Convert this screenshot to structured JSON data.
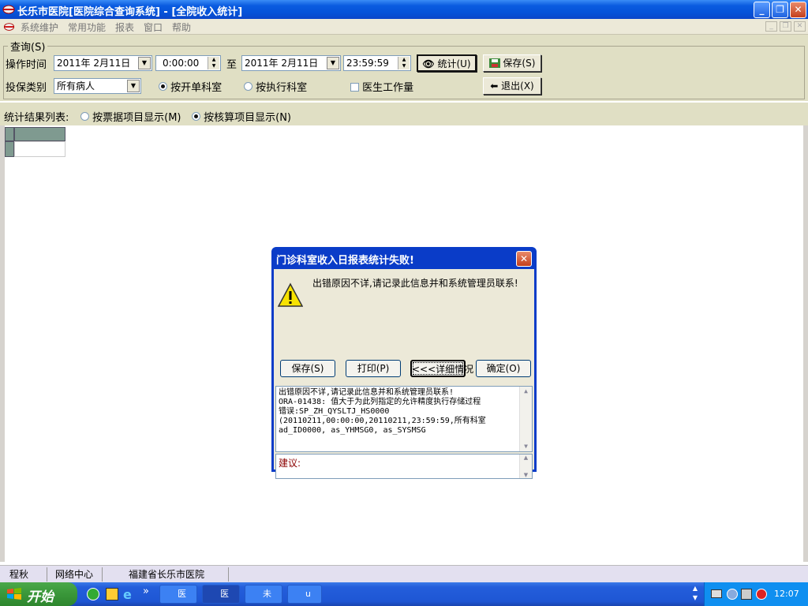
{
  "window": {
    "title": "长乐市医院[医院综合查询系统] - [全院收入统计]",
    "min": "_",
    "restore": "❐",
    "close": "✕"
  },
  "menu": {
    "items": [
      "系统维护",
      "常用功能",
      "报表",
      "窗口",
      "帮助"
    ],
    "mdi_min": "_",
    "mdi_restore": "❐",
    "mdi_close": "✕"
  },
  "query": {
    "group_label": "查询(S)",
    "time_label": "操作时间",
    "from_date": "2011年 2月11日",
    "from_time": "0:00:00",
    "to_label": "至",
    "to_date": "2011年 2月11日",
    "to_time": "23:59:59",
    "stat_button": "统计(U)",
    "save_button": "保存(S)",
    "insurance_label": "投保类别",
    "insurance_value": "所有病人",
    "radio_billing_dept": "按开单科室",
    "radio_exec_dept": "按执行科室",
    "check_doctor": "医生工作量",
    "exit_button": "退出(X)"
  },
  "results": {
    "label": "统计结果列表:",
    "radio_invoice": "按票据项目显示(M)",
    "radio_accounting": "按核算项目显示(N)"
  },
  "dialog": {
    "title": "门诊科室收入日报表统计失败!",
    "message": "出错原因不详,请记录此信息并和系统管理员联系!",
    "btn_save": "保存(S)",
    "btn_print": "打印(P)",
    "btn_details": "<<<详细情况",
    "btn_ok": "确定(O)",
    "details": [
      "出错原因不详,请记录此信息并和系统管理员联系!",
      "ORA-01438: 值大于为此列指定的允许精度执行存储过程",
      "错误:SP_ZH_QYSLTJ_HS0000",
      "(20110211,00:00:00,20110211,23:59:59,所有科室",
      "ad_ID0000, as_YHMSG0, as_SYSMSG"
    ],
    "suggest_label": "建议:"
  },
  "statusbar": {
    "user": "程秋",
    "network": "网络中心",
    "org": "福建省长乐市医院"
  },
  "taskbar": {
    "start": "开始",
    "buttons": [
      "医",
      "医",
      "未",
      "u"
    ],
    "more": "»",
    "clock": "12:07"
  },
  "icons": {
    "warning": "warning-icon",
    "binoculars": "binoculars-icon",
    "save": "save-icon",
    "exit": "exit-door-icon"
  },
  "colors": {
    "titlebar": "#0552d8",
    "panel": "#e0dfc4",
    "dialog_border": "#0a3cc8",
    "suggest_text": "#8b0000"
  }
}
